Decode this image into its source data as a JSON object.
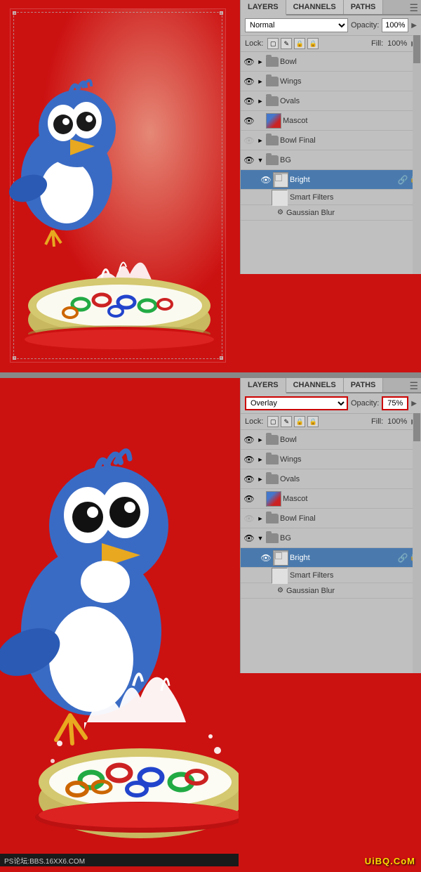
{
  "panels": {
    "tabs": [
      "LAYERS",
      "CHANNELS",
      "PATHS"
    ],
    "active_tab_top": "LAYERS",
    "active_tab_bottom": "LAYERS",
    "menu_icon": "☰"
  },
  "top_panel": {
    "blend_mode": "Normal",
    "opacity_label": "Opacity:",
    "opacity_value": "100%",
    "fill_label": "Fill:",
    "fill_value": "100%",
    "lock_label": "Lock:",
    "layers": [
      {
        "name": "Bowl",
        "type": "folder",
        "visible": true,
        "indent": 0
      },
      {
        "name": "Wings",
        "type": "folder",
        "visible": true,
        "indent": 0
      },
      {
        "name": "Ovals",
        "type": "folder",
        "visible": true,
        "indent": 0
      },
      {
        "name": "Mascot",
        "type": "layer",
        "visible": true,
        "indent": 0,
        "thumb": "mascot"
      },
      {
        "name": "Bowl Final",
        "type": "folder",
        "visible": false,
        "indent": 0
      },
      {
        "name": "BG",
        "type": "folder",
        "visible": true,
        "expanded": true,
        "indent": 0
      },
      {
        "name": "Bright",
        "type": "layer",
        "visible": true,
        "selected": true,
        "indent": 1,
        "thumb": "bright"
      },
      {
        "name": "Smart Filters",
        "type": "smart-filters",
        "indent": 2
      },
      {
        "name": "Gaussian Blur",
        "type": "filter",
        "indent": 3
      }
    ]
  },
  "bottom_panel": {
    "blend_mode": "Overlay",
    "opacity_label": "Opacity:",
    "opacity_value": "75%",
    "fill_label": "Fill:",
    "fill_value": "100%",
    "lock_label": "Lock:",
    "layers": [
      {
        "name": "Bowl",
        "type": "folder",
        "visible": true,
        "indent": 0
      },
      {
        "name": "Wings",
        "type": "folder",
        "visible": true,
        "indent": 0
      },
      {
        "name": "Ovals",
        "type": "folder",
        "visible": true,
        "indent": 0
      },
      {
        "name": "Mascot",
        "type": "layer",
        "visible": true,
        "indent": 0,
        "thumb": "mascot"
      },
      {
        "name": "Bowl Final",
        "type": "folder",
        "visible": false,
        "indent": 0
      },
      {
        "name": "BG",
        "type": "folder",
        "visible": true,
        "expanded": true,
        "indent": 0
      },
      {
        "name": "Bright",
        "type": "layer",
        "visible": true,
        "selected": true,
        "indent": 1,
        "thumb": "bright"
      },
      {
        "name": "Smart Filters",
        "type": "smart-filters",
        "indent": 2
      },
      {
        "name": "Gaussian Blur",
        "type": "filter",
        "indent": 3
      }
    ]
  },
  "watermark": {
    "text": "UiBQ.CoM"
  },
  "ps_bar": {
    "text": "PS论坛:BBS.16XX6.COM"
  }
}
